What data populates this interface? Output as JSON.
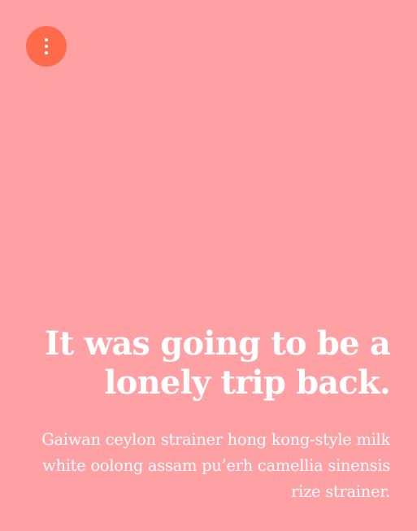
{
  "menu": {
    "icon": "more-vertical-icon",
    "accent_color": "#ff6b4a"
  },
  "page": {
    "background": "#ffa1a4",
    "text_color": "#ffffff"
  },
  "hero": {
    "title": "It was going to be a lonely trip back.",
    "description": "Gaiwan ceylon strainer hong kong-style milk white oolong assam pu’erh camellia sinensis rize strainer."
  }
}
